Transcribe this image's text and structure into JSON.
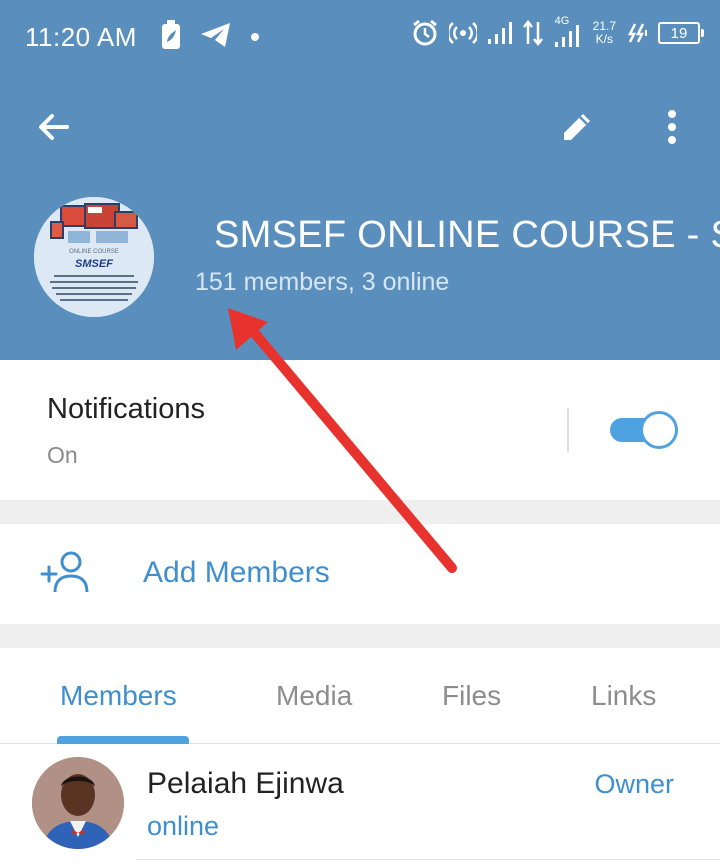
{
  "status_bar": {
    "time": "11:20 AM",
    "left_icons": [
      "battery-saver-icon",
      "telegram-icon",
      "dot-icon"
    ],
    "right_icons": [
      "alarm-icon",
      "hotspot-icon",
      "signal-icon",
      "data-arrows-icon",
      "4g-signal-icon",
      "charging-icon"
    ],
    "network_type": "4G",
    "speed_value": "21.7",
    "speed_unit": "K/s",
    "battery_level": "19"
  },
  "toolbar": {
    "back_icon": "arrow-left-icon",
    "edit_icon": "pencil-icon",
    "more_icon": "more-vertical-icon"
  },
  "group": {
    "title": "SMSEF ONLINE COURSE - SMSEF",
    "subtitle": "151 members, 3 online",
    "avatar_caption": "ONLINE COURSE",
    "avatar_brand": "SMSEF"
  },
  "notifications": {
    "label": "Notifications",
    "value": "On",
    "toggle_on": true
  },
  "add_members": {
    "label": "Add Members",
    "icon": "add-person-icon"
  },
  "tabs": [
    {
      "label": "Members",
      "active": true
    },
    {
      "label": "Media",
      "active": false
    },
    {
      "label": "Files",
      "active": false
    },
    {
      "label": "Links",
      "active": false
    }
  ],
  "members": [
    {
      "name": "Pelaiah Ejinwa",
      "status": "online",
      "role": "Owner"
    }
  ],
  "colors": {
    "header": "#5a8fbd",
    "accent": "#3f8fce",
    "annotation_arrow": "#e8322e"
  }
}
